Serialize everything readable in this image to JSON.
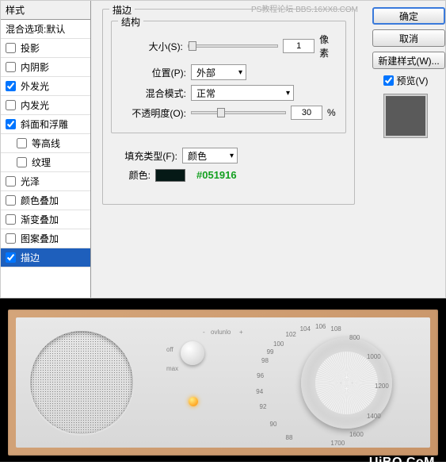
{
  "watermark": "PS教程论坛\nBBS.16XX8.COM",
  "styles_panel": {
    "header": "样式",
    "blend_options": "混合选项:默认",
    "items": [
      {
        "label": "投影",
        "checked": false
      },
      {
        "label": "内阴影",
        "checked": false
      },
      {
        "label": "外发光",
        "checked": true
      },
      {
        "label": "内发光",
        "checked": false
      },
      {
        "label": "斜面和浮雕",
        "checked": true
      },
      {
        "label": "等高线",
        "checked": false,
        "sub": true
      },
      {
        "label": "纹理",
        "checked": false,
        "sub": true
      },
      {
        "label": "光泽",
        "checked": false
      },
      {
        "label": "颜色叠加",
        "checked": false
      },
      {
        "label": "渐变叠加",
        "checked": false
      },
      {
        "label": "图案叠加",
        "checked": false
      },
      {
        "label": "描边",
        "checked": true,
        "selected": true
      }
    ]
  },
  "main": {
    "title": "描边",
    "structure": {
      "title": "结构",
      "size_label": "大小(S):",
      "size_value": "1",
      "size_unit": "像素",
      "position_label": "位置(P):",
      "position_value": "外部",
      "blend_label": "混合模式:",
      "blend_value": "正常",
      "opacity_label": "不透明度(O):",
      "opacity_value": "30",
      "opacity_unit": "%"
    },
    "fill": {
      "fill_type_label": "填充类型(F):",
      "fill_type_value": "颜色",
      "color_label": "颜色:",
      "color_hex": "#051916"
    }
  },
  "right": {
    "ok": "确定",
    "cancel": "取消",
    "new_style": "新建样式(W)...",
    "preview": "预览(V)"
  },
  "radio": {
    "brand": "ovlunlo",
    "off": "off",
    "max": "max",
    "minus": "-",
    "plus": "+",
    "freqs": [
      "88",
      "90",
      "92",
      "94",
      "96",
      "98",
      "99",
      "100",
      "102",
      "104",
      "106",
      "108",
      "800",
      "1000",
      "1200",
      "1400",
      "1600",
      "1700"
    ],
    "credit": "UiBQ.CoM"
  }
}
